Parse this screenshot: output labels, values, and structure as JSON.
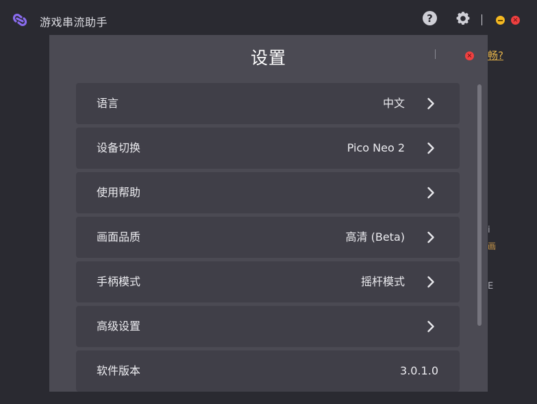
{
  "app": {
    "title": "游戏串流助手",
    "logo_icon": "link-chain-icon",
    "accent_color": "#8a6cf0"
  },
  "titlebar": {
    "help_label": "?",
    "close_glyph": "×"
  },
  "background": {
    "link_text": "畅?",
    "frag_1": "i",
    "frag_2": "画",
    "frag_3": "E"
  },
  "modal": {
    "title": "设置",
    "close_glyph": "×"
  },
  "settings": {
    "items": [
      {
        "label": "语言",
        "value": "中文",
        "has_chevron": true
      },
      {
        "label": "设备切换",
        "value": "Pico Neo 2",
        "has_chevron": true
      },
      {
        "label": "使用帮助",
        "value": "",
        "has_chevron": true
      },
      {
        "label": "画面品质",
        "value": "高清 (Beta)",
        "has_chevron": true
      },
      {
        "label": "手柄模式",
        "value": "摇杆模式",
        "has_chevron": true
      },
      {
        "label": "高级设置",
        "value": "",
        "has_chevron": true
      },
      {
        "label": "软件版本",
        "value": "3.0.1.0",
        "has_chevron": false
      }
    ]
  },
  "colors": {
    "background": "#2a2a31",
    "modal": "#4b4a53",
    "row": "#403f48",
    "minimize": "#f5b921",
    "close": "#ef4040",
    "link": "#e2b14a"
  }
}
